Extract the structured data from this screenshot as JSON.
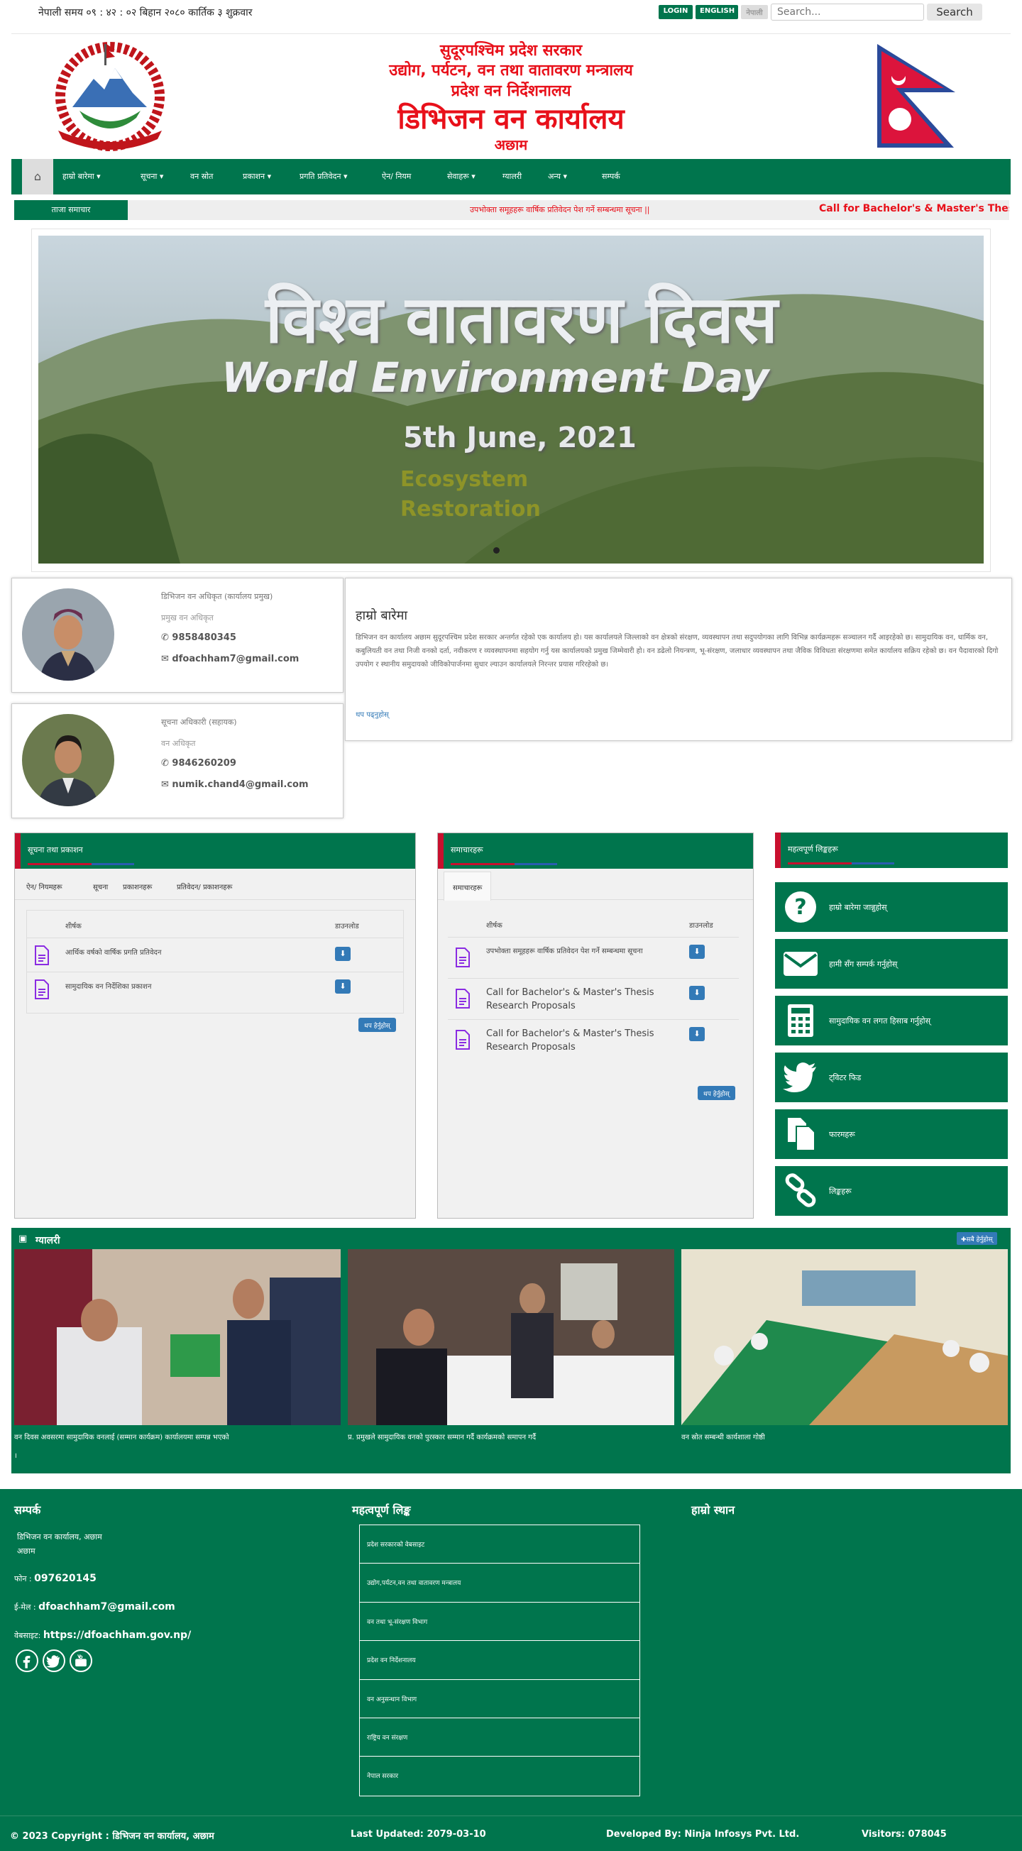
{
  "topbar": {
    "datetime": "नेपाली समय ०९ : ४२ : ०२ बिहान   २०८० कार्तिक ३ शुक्रवार",
    "login": "LOGIN",
    "english": "ENGLISH",
    "nepali": "नेपाली",
    "search_placeholder": "Search...",
    "search_button": "Search"
  },
  "header": {
    "line1": "सुदूरपश्चिम प्रदेश सरकार",
    "line2": "उद्योग, पर्यटन, वन तथा वातावरण मन्त्रालय",
    "line3": "प्रदेश वन निर्देशनालय",
    "line4": "डिभिजन वन कार्यालय",
    "line5": "अछाम"
  },
  "nav": {
    "home_icon": "home-icon",
    "items": [
      "हाम्रो बारेमा ▾",
      "सूचना ▾",
      "वन स्रोत",
      "प्रकाशन ▾",
      "प्रगति प्रतिवेदन ▾",
      "ऐन/ नियम",
      "सेवाहरू ▾",
      "ग्यालरी",
      "अन्य ▾",
      "सम्पर्क"
    ]
  },
  "ticker": {
    "label": "ताजा समाचार",
    "text": "उपभोक्ता समूहहरू वार्षिक प्रतिवेदन पेश गर्ने सम्बन्धमा सूचना ||",
    "text2": "Call for Bachelor's & Master's Thesis Re"
  },
  "slider": {
    "caption1": "विश्व वातावरण दिवस",
    "caption2": "World Environment Day",
    "caption3": "5th June, 2021",
    "caption4": "Ecosystem",
    "caption5": "Restoration"
  },
  "officials": [
    {
      "name": "डिभिजन वन अधिकृत (कार्यालय प्रमुख)",
      "title": "प्रमुख वन अधिकृत",
      "phone": "9858480345",
      "email": "dfoachham7@gmail.com"
    },
    {
      "name": "सूचना अधिकारी (सहायक)",
      "title": "वन अधिकृत",
      "phone": "9846260209",
      "email": "numik.chand4@gmail.com"
    }
  ],
  "about": {
    "title": "हाम्रो बारेमा",
    "text": "डिभिजन वन कार्यालय अछाम सुदूरपश्चिम प्रदेश सरकार अन्तर्गत रहेको एक कार्यालय हो। यस कार्यालयले जिल्लाको वन क्षेत्रको संरक्षण, व्यवस्थापन तथा सदुपयोगका लागि विभिन्न कार्यक्रमहरू सञ्चालन गर्दै आइरहेको छ। सामुदायिक वन, धार्मिक वन, कबुलियती वन तथा निजी वनको दर्ता, नवीकरण र व्यवस्थापनमा सहयोग गर्नु यस कार्यालयको प्रमुख जिम्मेवारी हो। वन डढेलो नियन्त्रण, भू-संरक्षण, जलाधार व्यवस्थापन तथा जैविक विविधता संरक्षणमा समेत कार्यालय सक्रिय रहेको छ। वन पैदावारको दिगो उपयोग र स्थानीय समुदायको जीविकोपार्जनमा सुधार ल्याउन कार्यालयले निरन्तर प्रयास गरिरहेको छ।",
    "more": "थप पढ्नुहोस्"
  },
  "notices": {
    "title": "सूचना तथा प्रकाशन",
    "tabs": [
      "ऐन/ नियमहरू",
      "सूचना",
      "प्रकाशनहरू",
      "प्रतिवेदन/ प्रकाशनहरू"
    ],
    "headers": [
      "शीर्षक",
      "डाउनलोड"
    ],
    "rows": [
      "आर्थिक वर्षको वार्षिक प्रगति प्रतिवेदन",
      "सामुदायिक वन निर्देशिका प्रकाशन"
    ],
    "more": "थप हेर्नुहोस्"
  },
  "news": {
    "title": "समाचारहरू",
    "tabs": [
      "समाचारहरू"
    ],
    "headers": [
      "शीर्षक",
      "डाउनलोड"
    ],
    "rows": [
      "उपभोक्ता समूहहरू वार्षिक प्रतिवेदन पेश गर्ने सम्बन्धमा सूचना",
      "Call for Bachelor's & Master's Thesis Research Proposals",
      "Call for Bachelor's & Master's Thesis Research Proposals"
    ],
    "more": "थप हेर्नुहोस्"
  },
  "quick": {
    "title": "महत्वपूर्ण लिङ्कहरू",
    "items": [
      {
        "label": "हाम्रो बारेमा जान्नुहोस्",
        "icon": "question-icon"
      },
      {
        "label": "हामी सँग सम्पर्क गर्नुहोस्",
        "icon": "envelope-icon"
      },
      {
        "label": "सामुदायिक वन लगत हिसाब गर्नुहोस्",
        "icon": "calculator-icon"
      },
      {
        "label": "ट्विटर फिड",
        "icon": "twitter-icon"
      },
      {
        "label": "फारमहरू",
        "icon": "documents-icon"
      },
      {
        "label": "लिङ्कहरू",
        "icon": "link-icon"
      }
    ]
  },
  "gallery": {
    "title": "ग्यालरी",
    "button": "✚सबै हेर्नुहोस्",
    "captions": [
      "वन दिवस अवसरमा सामुदायिक वनलाई (सम्मान कार्यक्रम) कार्यालयमा सम्पन्न भएको",
      "प्र. प्रमुखले सामुदायिक वनको पुरस्कार सम्मान गर्दै कार्यक्रमको समापन गर्दै",
      "वन स्रोत सम्बन्धी कार्यशाला गोष्ठी"
    ],
    "extra": "।"
  },
  "footer": {
    "contact_title": "सम्पर्क",
    "address": "डिभिजन वन कार्यालय, अछाम",
    "address2": "अछाम",
    "phone_label": "फोन : ",
    "phone": "097620145",
    "email_label": "ई-मेल : ",
    "email": "dfoachham7@gmail.com",
    "web_label": "वेबसाइट: ",
    "web": "https://dfoachham.gov.np/",
    "links_title": "महत्वपूर्ण लिङ्क",
    "links": [
      "प्रदेश सरकारको वेबसाइट",
      "उद्योग,पर्यटन,वन तथा वातावरण मन्त्रालय",
      "वन तथा भू-संरक्षण विभाग",
      "प्रदेश वन निर्देशनालय",
      "वन अनुसन्धान विभाग",
      "राष्ट्रिय वन संरक्षण",
      "नेपाल सरकार"
    ],
    "map_title": "हाम्रो स्थान",
    "social": [
      "facebook-icon",
      "twitter-icon",
      "youtube-icon"
    ]
  },
  "copyright": {
    "copy": "© 2023 Copyright : डिभिजन वन कार्यालय, अछाम",
    "updated": "Last Updated: 2079-03-10",
    "developed": "Developed By: Ninja Infosys Pvt. Ltd.",
    "visitors": "Visitors: 078045"
  },
  "colors": {
    "primary": "#00754d",
    "accent": "#e8101a",
    "link": "#337ab7"
  }
}
